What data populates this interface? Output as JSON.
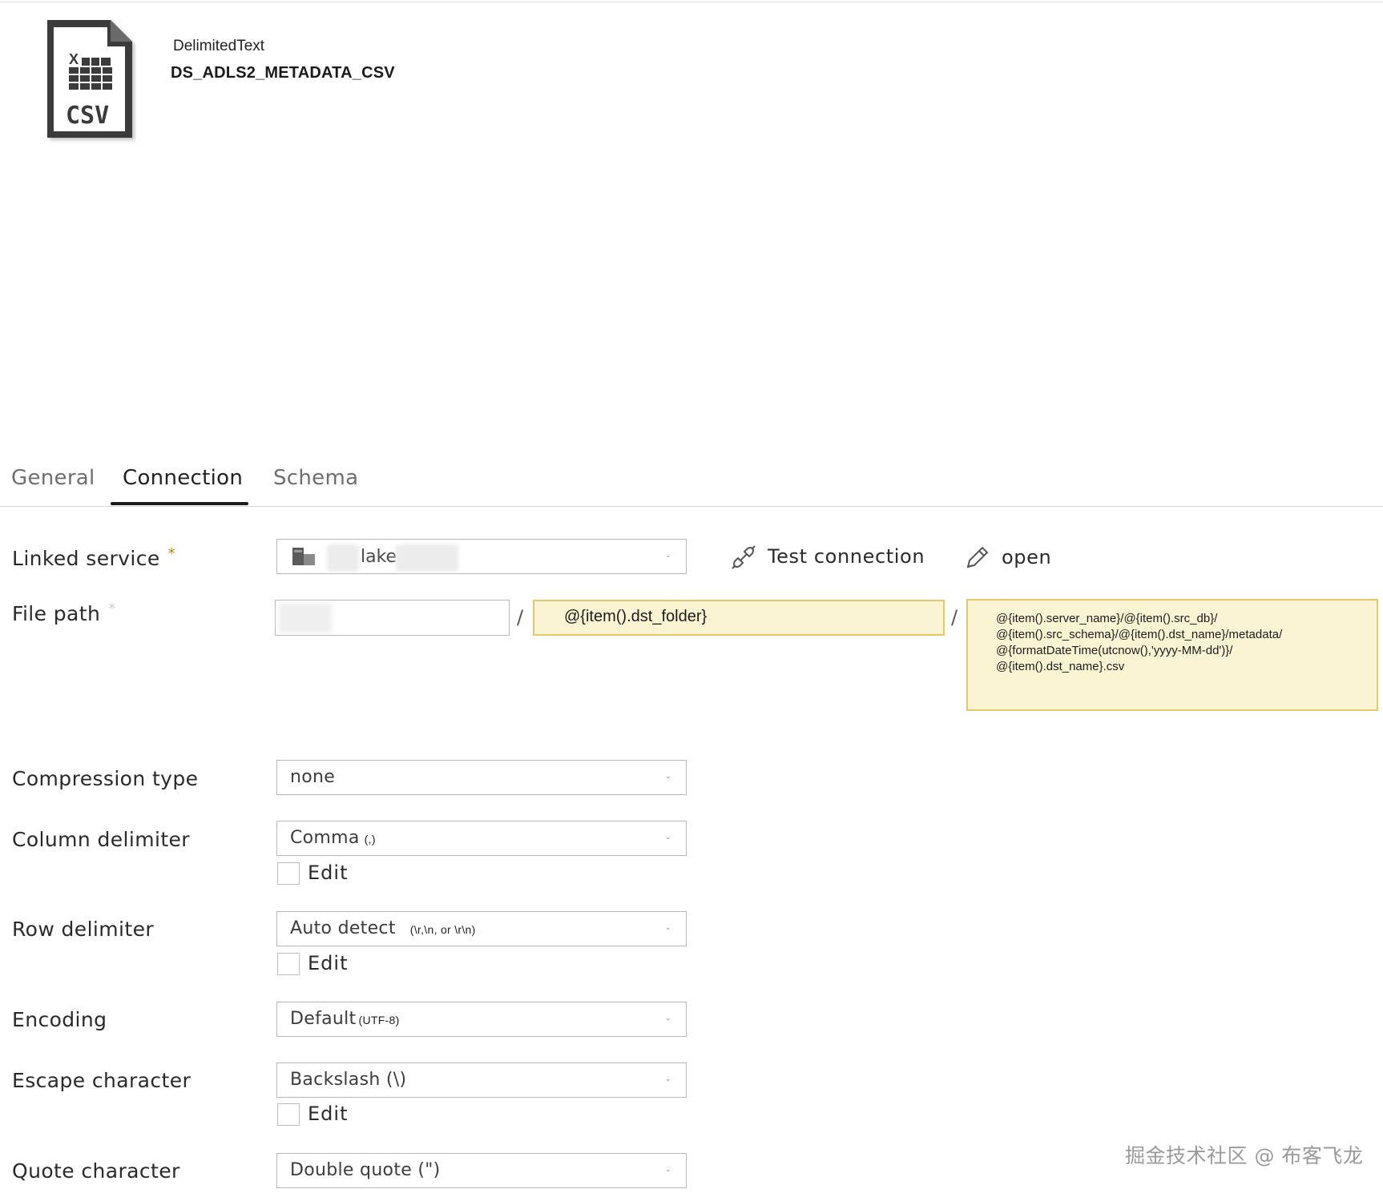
{
  "header": {
    "icon_label": "CSV",
    "dataset_type": "DelimitedText",
    "dataset_name": "DS_ADLS2_METADATA_CSV"
  },
  "tabs": [
    {
      "label": "General",
      "active": false
    },
    {
      "label": "Connection",
      "active": true
    },
    {
      "label": "Schema",
      "active": false
    }
  ],
  "linked_service": {
    "label": "Linked service",
    "required_mark": "*",
    "value": "lake",
    "test_connection_label": "Test connection",
    "open_label": "open"
  },
  "file_path": {
    "label": "File path",
    "required_mark": "*",
    "separator": "/",
    "directory": "@{item().dst_folder}",
    "file_name_lines": [
      "@{item().server_name}/@{item().src_db}/",
      "@{item().src_schema}/@{item().dst_name}/metadata/",
      "@{formatDateTime(utcnow(),'yyyy-MM-dd')}/",
      "@{item().dst_name}.csv"
    ]
  },
  "compression": {
    "label": "Compression type",
    "value": "none"
  },
  "column_delimiter": {
    "label": "Column delimiter",
    "value": "Comma",
    "hint": "(,)",
    "edit_label": "Edit"
  },
  "row_delimiter": {
    "label": "Row delimiter",
    "value": "Auto detect",
    "hint": "(\\r,\\n, or \\r\\n)",
    "edit_label": "Edit"
  },
  "encoding": {
    "label": "Encoding",
    "value": "Default",
    "hint": "(UTF-8)"
  },
  "escape_character": {
    "label": "Escape character",
    "value": "Backslash (\\)",
    "edit_label": "Edit"
  },
  "quote_character": {
    "label": "Quote character",
    "value": "Double quote (\")"
  },
  "watermark": "掘金技术社区 @ 布客飞龙",
  "colors": {
    "expression_bg": "#fbf4d3",
    "expression_border": "#e4c86a",
    "required": "#b8860b"
  }
}
